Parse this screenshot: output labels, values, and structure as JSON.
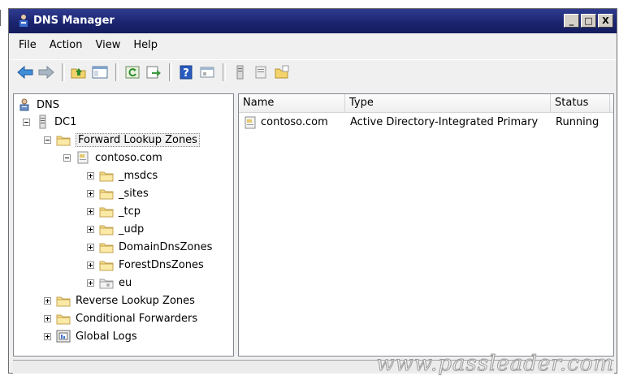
{
  "window": {
    "title": "DNS Manager",
    "minimize": "_",
    "maximize": "□",
    "close": "X"
  },
  "menu": {
    "items": [
      "File",
      "Action",
      "View",
      "Help"
    ]
  },
  "toolbar": {
    "icons": [
      "back-arrow-icon",
      "forward-arrow-icon",
      "up-folder-icon",
      "show-hide-console-tree-icon",
      "refresh-icon",
      "export-list-icon",
      "help-icon",
      "console-icon",
      "server-icon",
      "zone-icon",
      "new-zone-icon"
    ]
  },
  "tree": {
    "root": "DNS",
    "server": "DC1",
    "forward_zones": "Forward Lookup Zones",
    "zone": "contoso.com",
    "subfolders": [
      "_msdcs",
      "_sites",
      "_tcp",
      "_udp",
      "DomainDnsZones",
      "ForestDnsZones",
      "eu"
    ],
    "reverse_zones": "Reverse Lookup Zones",
    "conditional_forwarders": "Conditional Forwarders",
    "global_logs": "Global Logs"
  },
  "list": {
    "columns": {
      "name": "Name",
      "type": "Type",
      "status": "Status"
    },
    "rows": [
      {
        "name": "contoso.com",
        "type": "Active Directory-Integrated Primary",
        "status": "Running"
      }
    ]
  },
  "watermark": "www.passleader.com"
}
